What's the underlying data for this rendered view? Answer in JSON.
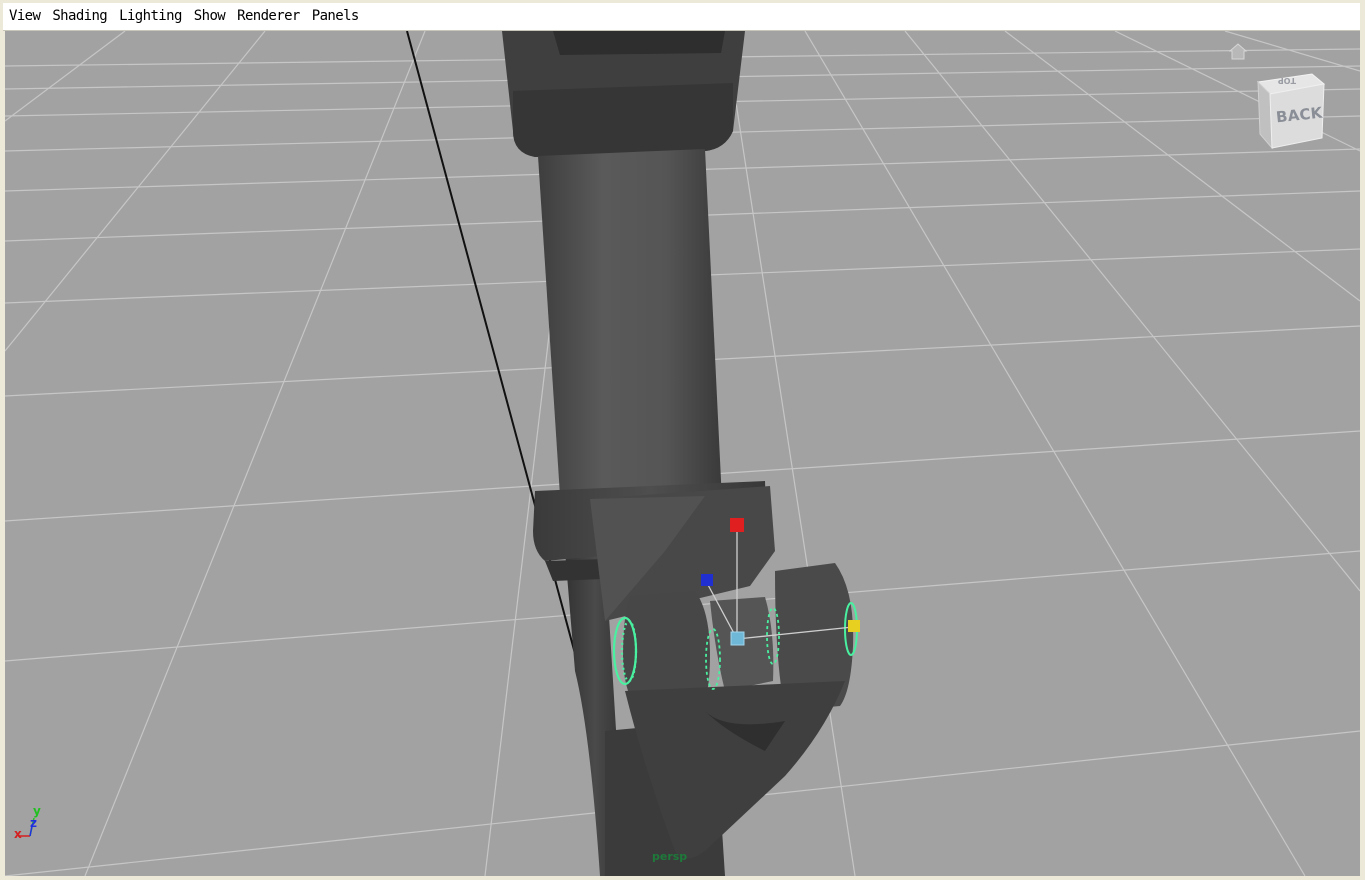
{
  "menubar": {
    "items": [
      {
        "label": "View"
      },
      {
        "label": "Shading"
      },
      {
        "label": "Lighting"
      },
      {
        "label": "Show"
      },
      {
        "label": "Renderer"
      },
      {
        "label": "Panels"
      }
    ]
  },
  "viewport": {
    "background_color": "#a2a2a2",
    "grid_color": "#cfcfcf",
    "mesh_color": "#4a4a4a",
    "selection_color": "#49f0a0"
  },
  "viewcube": {
    "face_label": "BACK",
    "top_label": "TOP",
    "icon": "home-icon"
  },
  "axis_indicator": {
    "x_label": "x",
    "y_label": "y",
    "z_label": "z",
    "x_color": "#d42020",
    "y_color": "#20c020",
    "z_color": "#2030e0"
  },
  "manipulator": {
    "x_handle_color": "#e8d020",
    "y_handle_color": "#e02020",
    "z_handle_color": "#2030d0",
    "center_color": "#70b8d8"
  },
  "object_label": "persp"
}
